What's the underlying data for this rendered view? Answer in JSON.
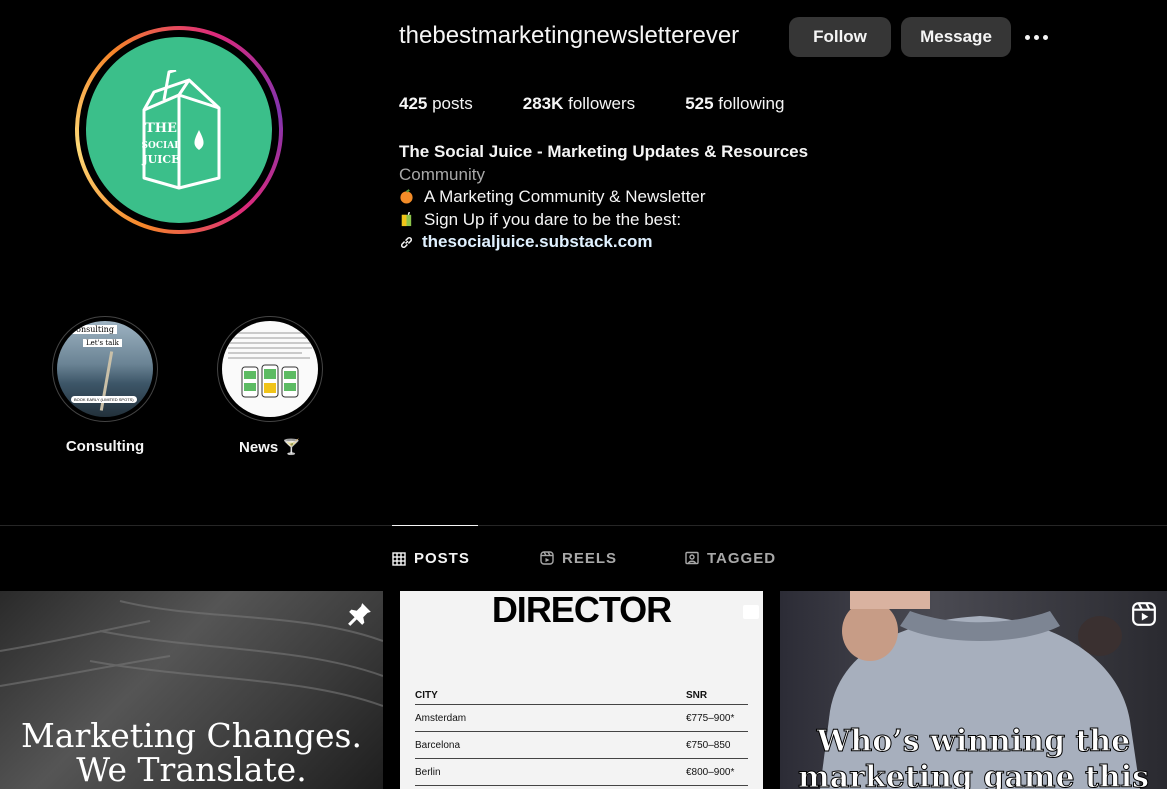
{
  "profile": {
    "username": "thebestmarketingnewsletterever",
    "follow_label": "Follow",
    "message_label": "Message",
    "avatar_text": [
      "THE",
      "SOCIAL",
      "JUICE"
    ]
  },
  "stats": {
    "posts_count": "425",
    "posts_label": " posts",
    "followers_count": "283K",
    "followers_label": " followers",
    "following_count": "525",
    "following_label": " following"
  },
  "bio": {
    "name": "The Social Juice - Marketing Updates & Resources",
    "category": "Community",
    "line1": "A Marketing Community & Newsletter",
    "line2": "Sign Up if you dare to be the best:",
    "link": "thesocialjuice.substack.com"
  },
  "highlights": [
    {
      "label": "Consulting",
      "overlay_top": "Consulting",
      "overlay_mid": "Let's talk",
      "overlay_bottom": "BOOK EARLY (LIMITED SPOTS)"
    },
    {
      "label": "News 🍸"
    }
  ],
  "tabs": [
    {
      "label": "POSTS",
      "icon": "grid-icon",
      "active": true
    },
    {
      "label": "REELS",
      "icon": "reels-icon",
      "active": false
    },
    {
      "label": "TAGGED",
      "icon": "tagged-icon",
      "active": false
    }
  ],
  "posts": {
    "post1_line1": "Marketing Changes.",
    "post1_line2": "We Translate.",
    "post2_title": "DIRECTOR",
    "post2_headers": [
      "CITY",
      "SNR"
    ],
    "post2_rows": [
      [
        "Amsterdam",
        "€775–900*"
      ],
      [
        "Barcelona",
        "€750–850"
      ],
      [
        "Berlin",
        "€800–900*"
      ]
    ],
    "post3_line1": "Who’s winning the",
    "post3_line2": "marketing game this"
  },
  "colors": {
    "background": "#000000",
    "button": "#363636",
    "avatar_green": "#3bbf8a",
    "link": "#e0f1ff"
  }
}
